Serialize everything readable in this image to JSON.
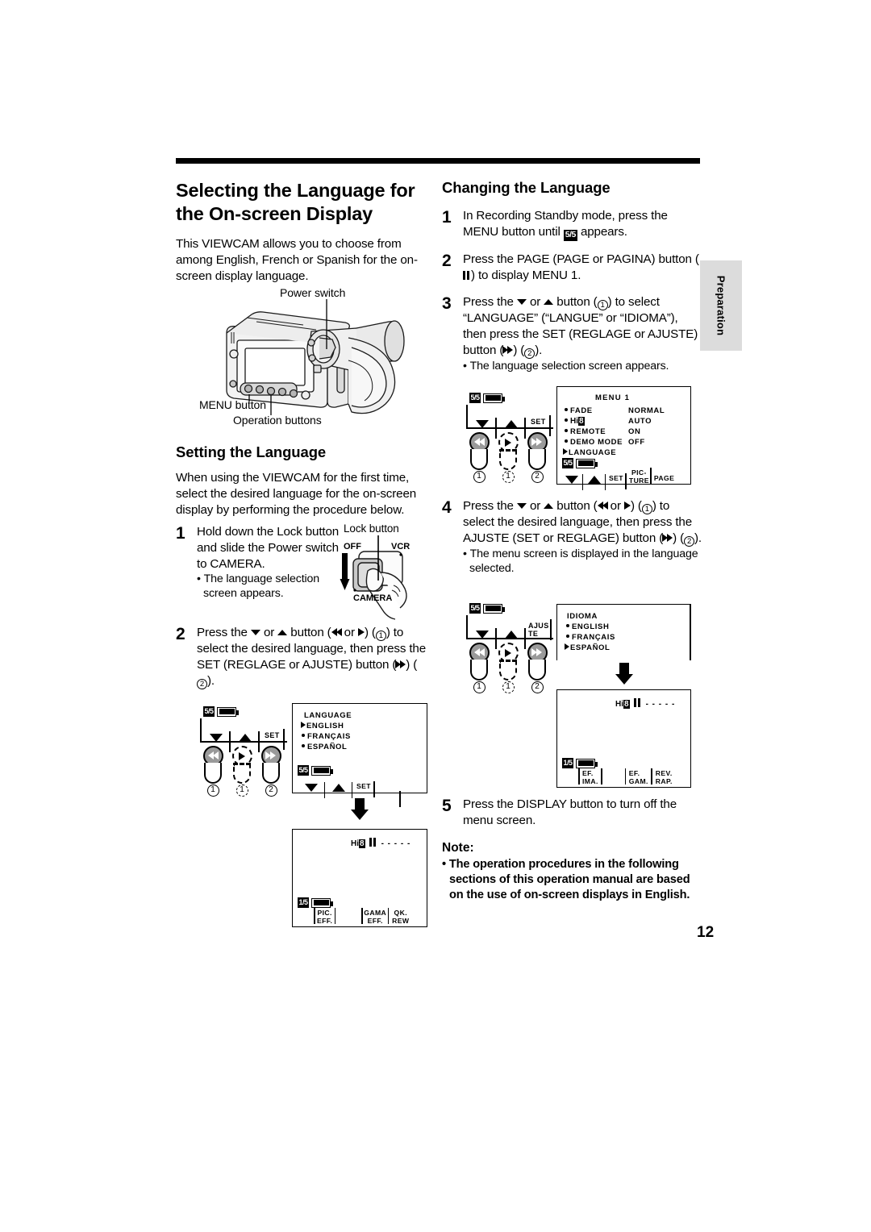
{
  "page": {
    "number": "12",
    "side_tab": "Preparation"
  },
  "left_column": {
    "title": "Selecting the Language for the On-screen Display",
    "intro": "This VIEWCAM allows you to choose from among English, French or Spanish for the on-screen display language.",
    "camera_figure": {
      "label_power_switch": "Power switch",
      "label_menu_button": "MENU button",
      "label_operation_buttons": "Operation buttons"
    },
    "section_title": "Setting the Language",
    "section_intro": "When using the VIEWCAM for the first time, select the desired language for the on-screen display by performing the procedure below.",
    "steps": [
      {
        "num": "1",
        "text_parts": [
          "Hold down the Lock button and slide the Power switch to CAMERA."
        ],
        "sub": "The language selection screen appears."
      },
      {
        "num": "2",
        "sub": ""
      }
    ],
    "step2_text": {
      "a": "Press the ",
      "b": " or ",
      "c": " button (",
      "d": " or ",
      "e": ") (",
      "f": "1",
      "g": ") to select the desired language, then press the SET (REGLAGE or AJUSTE) button (",
      "h": ") (",
      "i": "2",
      "j": ")."
    },
    "lock_figure": {
      "label": "Lock button",
      "pos_off": "OFF",
      "pos_vcr": "VCR",
      "pos_camera": "CAMERA"
    }
  },
  "right_column": {
    "section_title": "Changing the Language",
    "steps": [
      {
        "num": "1",
        "a": "In Recording Standby mode, press the MENU button until ",
        "badge": "5/5",
        "b": " appears."
      },
      {
        "num": "2",
        "a": "Press the PAGE (PAGE or PAGINA) button (",
        "b": ") to display MENU 1."
      },
      {
        "num": "3",
        "a": "Press the ",
        "b": " or ",
        "c": " button (",
        "d": "1",
        "e": ") to select “LANGUAGE” (“LANGUE” or “IDIOMA”), then press the SET (REGLAGE or AJUSTE) button (",
        "f": ") (",
        "g": "2",
        "h": ").",
        "sub": "The language selection screen appears."
      },
      {
        "num": "4",
        "a": "Press the ",
        "b": " or ",
        "c": " button (",
        "d": " or ",
        "e": ") (",
        "f": "1",
        "g": ") to select the desired language, then press the AJUSTE (SET or REGLAGE) button (",
        "h": ") (",
        "i": "2",
        "j": ").",
        "sub": "The menu screen is displayed in the language selected."
      },
      {
        "num": "5",
        "a": "Press the DISPLAY button to turn off the menu screen."
      }
    ],
    "note": {
      "heading": "Note:",
      "bullet": "The operation procedures in the following sections of this operation manual are based on the use of on-screen displays in English."
    }
  },
  "osd_screens": {
    "menu1": {
      "title": "MENU  1",
      "rows": [
        {
          "marker": "dot",
          "label": "FADE",
          "value": "NORMAL"
        },
        {
          "marker": "dot",
          "label": "Hi8",
          "value": "AUTO"
        },
        {
          "marker": "dot",
          "label": "REMOTE",
          "value": "ON"
        },
        {
          "marker": "dot",
          "label": "DEMO MODE",
          "value": "OFF"
        },
        {
          "marker": "arrow",
          "label": "LANGUAGE",
          "value": ""
        }
      ],
      "status_badge": "5/5",
      "softkeys": [
        "SET",
        "PIC-\nTURE",
        "PAGE"
      ],
      "softkey_set": "SET",
      "softkey_picture_top": "PIC-",
      "softkey_picture_bottom": "TURE",
      "softkey_page": "PAGE"
    },
    "language_en": {
      "title": "LANGUAGE",
      "rows": [
        {
          "marker": "arrow",
          "label": "ENGLISH"
        },
        {
          "marker": "dot",
          "label": "FRANÇAIS"
        },
        {
          "marker": "dot",
          "label": "ESPAÑOL"
        }
      ],
      "status_badge": "5/5",
      "softkey_set": "SET"
    },
    "language_es": {
      "title": "IDIOMA",
      "rows": [
        {
          "marker": "dot",
          "label": "ENGLISH"
        },
        {
          "marker": "dot",
          "label": "FRANÇAIS"
        },
        {
          "marker": "arrow",
          "label": "ESPAÑOL"
        }
      ]
    },
    "standby_en": {
      "hi8": "Hi8",
      "tape_dashes": "- - - - -",
      "status_badge": "1/5",
      "softkeys": [
        {
          "top": "PIC.",
          "bottom": "EFF."
        },
        {
          "top": "GAMA",
          "bottom": "EFF."
        },
        {
          "top": "QK.",
          "bottom": "REW"
        }
      ]
    },
    "standby_es": {
      "hi8": "Hi8",
      "tape_dashes": "- - - - -",
      "status_badge": "1/5",
      "softkeys": [
        {
          "top": "EF.",
          "bottom": "IMA."
        },
        {
          "top": "EF.",
          "bottom": "GAM."
        },
        {
          "top": "REV.",
          "bottom": "RAP."
        }
      ]
    }
  },
  "control_widgets": {
    "set_widget": {
      "badge": "5/5",
      "key_label": "SET",
      "thumbs": [
        {
          "icon": "rewind-icon",
          "number": "1",
          "dashed": false
        },
        {
          "icon": "play-icon",
          "number": "1",
          "dashed": true
        },
        {
          "icon": "forward-icon",
          "number": "2",
          "dashed": false
        }
      ]
    },
    "ajuste_widget": {
      "badge": "5/5",
      "key_label_top": "AJUS",
      "key_label_bottom": "TE",
      "thumbs": [
        {
          "icon": "rewind-icon",
          "number": "1",
          "dashed": false
        },
        {
          "icon": "play-icon",
          "number": "1",
          "dashed": true
        },
        {
          "icon": "forward-icon",
          "number": "2",
          "dashed": false
        }
      ]
    }
  }
}
